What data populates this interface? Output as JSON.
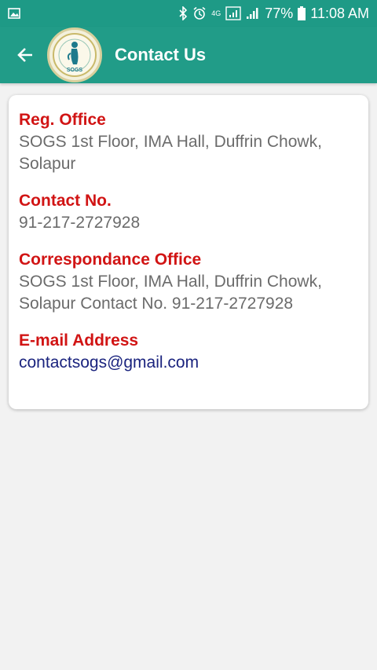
{
  "status_bar": {
    "network": "4G",
    "battery": "77%",
    "time": "11:08 AM"
  },
  "app_bar": {
    "title": "Contact Us",
    "logo_text": "SOGS"
  },
  "contact": {
    "reg_office_label": "Reg. Office",
    "reg_office_value": "SOGS 1st Floor, IMA Hall, Duffrin Chowk, Solapur",
    "contact_no_label": "Contact No.",
    "contact_no_value": "91-217-2727928",
    "corr_office_label": "Correspondance Office",
    "corr_office_value": "SOGS 1st Floor, IMA Hall, Duffrin Chowk, Solapur Contact No. 91-217-2727928",
    "email_label": "E-mail Address",
    "email_value": "contactsogs@gmail.com"
  },
  "colors": {
    "primary": "#219c88",
    "label": "#d11414",
    "email": "#1a237e"
  }
}
